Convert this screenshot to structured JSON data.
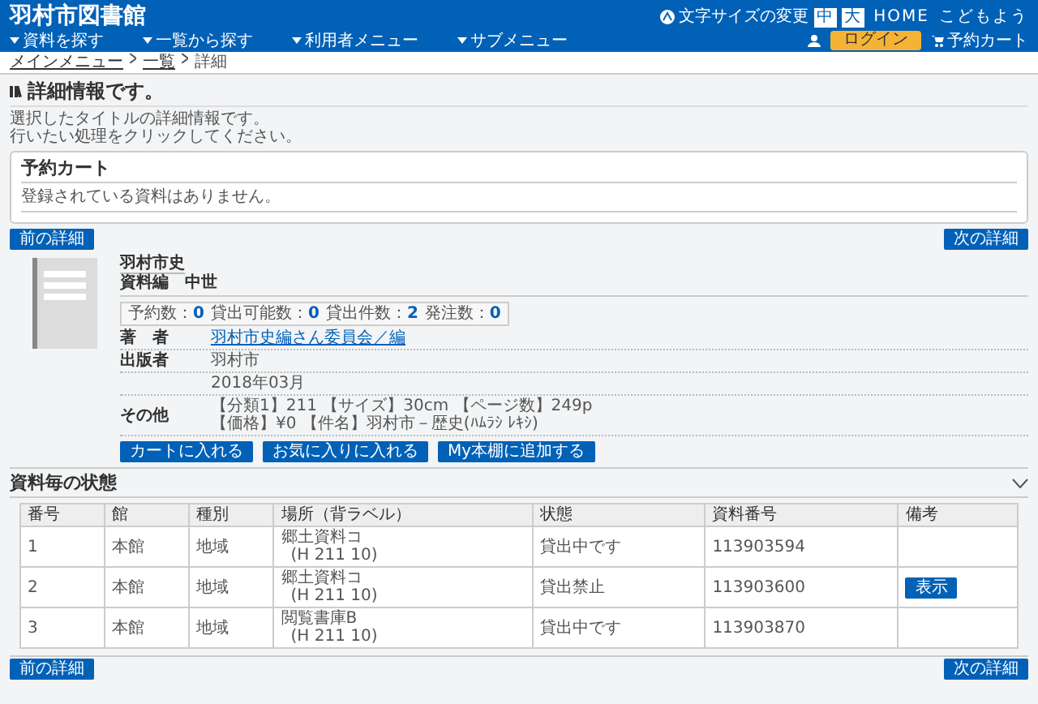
{
  "header": {
    "title": "羽村市図書館",
    "font_size_label": "文字サイズの変更",
    "font_sizes": [
      "中",
      "大"
    ],
    "links": [
      "HOME",
      "こどもよう"
    ],
    "menu": [
      "資料を探す",
      "一覧から探す",
      "利用者メニュー",
      "サブメニュー"
    ],
    "login": "ログイン",
    "cart": "予約カート"
  },
  "breadcrumb": [
    "メインメニュー",
    "一覧",
    "詳細"
  ],
  "page_title": "詳細情報です。",
  "intro": [
    "選択したタイトルの詳細情報です。",
    "行いたい処理をクリックしてください。"
  ],
  "cart_panel": {
    "title": "予約カート",
    "message": "登録されている資料はありません。"
  },
  "nav_buttons": {
    "prev": "前の詳細",
    "next": "次の詳細"
  },
  "book": {
    "title": "羽村市史",
    "subtitle": "資料編　中世",
    "counts": [
      {
        "label": "予約数：",
        "value": "0"
      },
      {
        "label": "貸出可能数：",
        "value": "0"
      },
      {
        "label": "貸出件数：",
        "value": "2"
      },
      {
        "label": "発注数：",
        "value": "0"
      }
    ],
    "details": [
      {
        "label": "著　者",
        "lines": [
          "羽村市史編さん委員会／編"
        ],
        "kind": "link"
      },
      {
        "label": "出版者",
        "lines": [
          "羽村市"
        ],
        "kind": "text"
      },
      {
        "lines": [
          "2018年03月"
        ],
        "kind": "text"
      },
      {
        "label": "その他",
        "lines": [
          "【分類1】211 【サイズ】30cm 【ページ数】249p",
          "【価格】¥0 【件名】羽村市－歴史(ﾊﾑﾗｼ ﾚｷｼ)"
        ],
        "kind": "text"
      }
    ],
    "actions": [
      "カートに入れる",
      "お気に入りに入れる",
      "My本棚に追加する"
    ]
  },
  "holdings": {
    "title": "資料毎の状態",
    "columns": [
      "番号",
      "館",
      "種別",
      "場所（背ラベル）",
      "状態",
      "資料番号",
      "備考"
    ],
    "rows": [
      {
        "number": "1",
        "library": "本館",
        "type": "地域",
        "location": "郷土資料コ",
        "call_number": "(H 211 10)",
        "status": "貸出中です",
        "item_id": "113903594"
      },
      {
        "number": "2",
        "library": "本館",
        "type": "地域",
        "location": "郷土資料コ",
        "call_number": "(H 211 10)",
        "status": "貸出禁止",
        "item_id": "113903600",
        "note_button": "表示"
      },
      {
        "number": "3",
        "library": "本館",
        "type": "地域",
        "location": "閲覧書庫B",
        "call_number": "(H 211 10)",
        "status": "貸出中です",
        "item_id": "113903870"
      }
    ]
  },
  "bottom_nav": {
    "prev": "前の詳細",
    "next": "次の詳細"
  }
}
